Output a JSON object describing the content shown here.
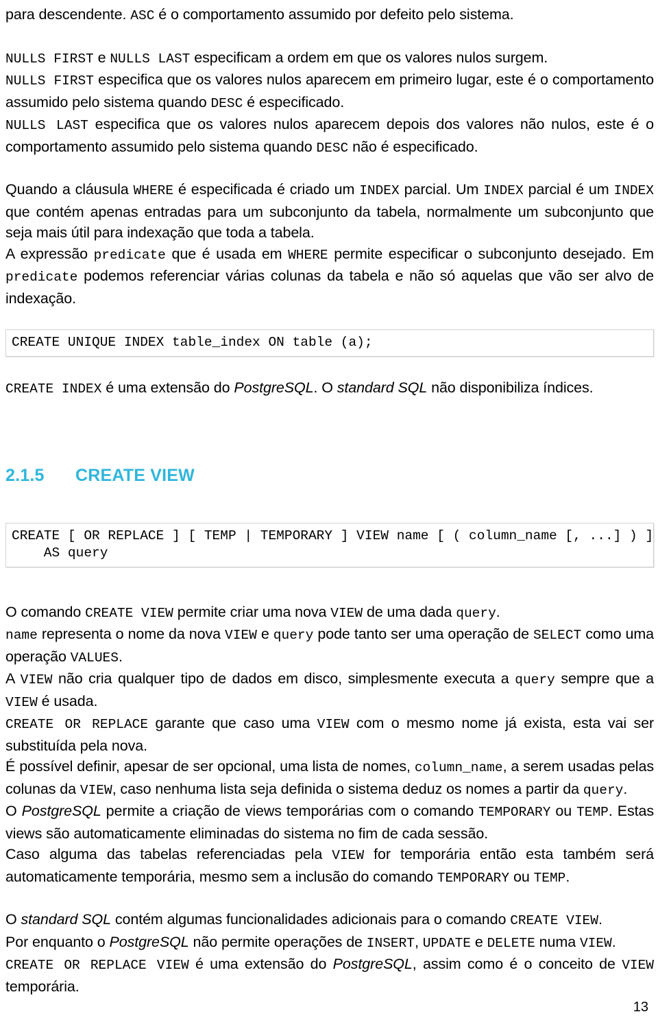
{
  "document": {
    "language": "pt",
    "page_number": "13",
    "heading_color": "#2FB6DC"
  },
  "paragraphs": {
    "p1_pre": "para descendente. ",
    "p1_code1": "ASC",
    "p1_post": " é o comportamento assumido por defeito pelo sistema.",
    "p2_l1_c1": "NULLS FIRST",
    "p2_l1_t1": " e ",
    "p2_l1_c2": "NULLS LAST",
    "p2_l1_t2": " especificam a ordem em que os valores nulos surgem.",
    "p2_l2_c1": "NULLS FIRST",
    "p2_l2_t1": " especifica que os valores nulos aparecem em primeiro lugar, este é o comportamento  assumido pelo sistema quando ",
    "p2_l2_c2": "DESC",
    "p2_l2_t2": " é especificado.",
    "p2_l3_c1": "NULLS LAST",
    "p2_l3_t1": " especifica que os valores nulos aparecem depois dos valores não nulos, este é o comportamento assumido pelo sistema quando ",
    "p2_l3_c2": "DESC",
    "p2_l3_t2": " não é especificado.",
    "p3_t1": "Quando a cláusula ",
    "p3_c1": "WHERE",
    "p3_t2": " é especificada é criado um ",
    "p3_c2": "INDEX",
    "p3_t3": " parcial. Um ",
    "p3_c3": "INDEX",
    "p3_t4": " parcial é um ",
    "p3_c4": "INDEX",
    "p3_t5": " que contém apenas entradas para um subconjunto da tabela, normalmente um subconjunto que seja mais útil para indexação que toda a tabela.",
    "p3_t6": "A expressão ",
    "p3_c5": "predicate",
    "p3_t7": " que é usada em ",
    "p3_c6": "WHERE",
    "p3_t8": " permite especificar o subconjunto desejado. Em ",
    "p3_c7": "predicate",
    "p3_t9": " podemos referenciar várias colunas da tabela e não só aquelas que vão ser alvo de indexação.",
    "p4_c1": "CREATE INDEX",
    "p4_t1": " é uma extensão do ",
    "p4_i1": "PostgreSQL",
    "p4_t2": ". O ",
    "p4_i2": "standard SQL",
    "p4_t3": " não disponibiliza índices.",
    "p5_t1": "O comando ",
    "p5_c1": "CREATE VIEW",
    "p5_t2": " permite criar uma nova ",
    "p5_c2": "VIEW",
    "p5_t3": " de uma dada ",
    "p5_c3": "query",
    "p5_t4": ".",
    "p5_c4": "name",
    "p5_t5": " representa o nome da nova ",
    "p5_c5": "VIEW",
    "p5_t6": " e ",
    "p5_c6": "query",
    "p5_t7": " pode tanto ser uma operação de ",
    "p5_c7": "SELECT",
    "p5_t8": " como uma operação ",
    "p5_c8": "VALUES",
    "p5_t9": ".",
    "p5_t10": "A ",
    "p5_c9": "VIEW",
    "p5_t11": " não cria qualquer tipo de dados em disco, simplesmente executa a ",
    "p5_c10": "query",
    "p5_t12": " sempre que a ",
    "p5_c11": "VIEW",
    "p5_t13": " é usada.",
    "p5_c12": "CREATE OR REPLACE",
    "p5_t14": " garante que caso uma ",
    "p5_c13": "VIEW",
    "p5_t15": " com o mesmo nome já exista, esta vai ser substituída pela nova.",
    "p5_t16": "É possível definir, apesar de ser opcional, uma lista de nomes, ",
    "p5_c14": "column_name",
    "p5_t17": ", a serem usadas pelas colunas da ",
    "p5_c15": "VIEW",
    "p5_t18": ", caso nenhuma lista seja definida o sistema deduz os nomes a partir da ",
    "p5_c16": "query",
    "p5_t19": ".",
    "p5_t20": "O ",
    "p5_i1": "PostgreSQL",
    "p5_t21": " permite a criação de views temporárias com o comando ",
    "p5_c17": "TEMPORARY",
    "p5_t22": " ou ",
    "p5_c18": "TEMP",
    "p5_t23": ". Estas views são automaticamente eliminadas do sistema no fim de cada sessão.",
    "p5_t24": "Caso alguma das tabelas referenciadas pela ",
    "p5_c19": "VIEW",
    "p5_t25": " for temporária então esta também será automaticamente temporária, mesmo sem a inclusão do comando ",
    "p5_c20": "TEMPORARY",
    "p5_t26": " ou ",
    "p5_c21": "TEMP",
    "p5_t27": ".",
    "p6_t1": "O ",
    "p6_i1": "standard SQL",
    "p6_t2": " contém algumas funcionalidades adicionais para o comando ",
    "p6_c1": "CREATE VIEW",
    "p6_t3": ".",
    "p6_t4": "Por enquanto o ",
    "p6_i2": "PostgreSQL",
    "p6_t5": " não permite operações de ",
    "p6_c2": "INSERT",
    "p6_t6": ", ",
    "p6_c3": "UPDATE",
    "p6_t7": " e ",
    "p6_c4": "DELETE",
    "p6_t8": " numa ",
    "p6_c5": "VIEW",
    "p6_t9": ".",
    "p6_c6": "CREATE OR REPLACE VIEW",
    "p6_t10": " é uma extensão do ",
    "p6_i3": "PostgreSQL",
    "p6_t11": ", assim como é o conceito de ",
    "p6_c7": "VIEW",
    "p6_t12": " temporária."
  },
  "code_blocks": {
    "create_index": "CREATE UNIQUE INDEX table_index ON table (a);",
    "create_view": "CREATE [ OR REPLACE ] [ TEMP | TEMPORARY ] VIEW name [ ( column_name [, ...] ) ]\n    AS query"
  },
  "section": {
    "number": "2.1.5",
    "title": "CREATE VIEW"
  }
}
